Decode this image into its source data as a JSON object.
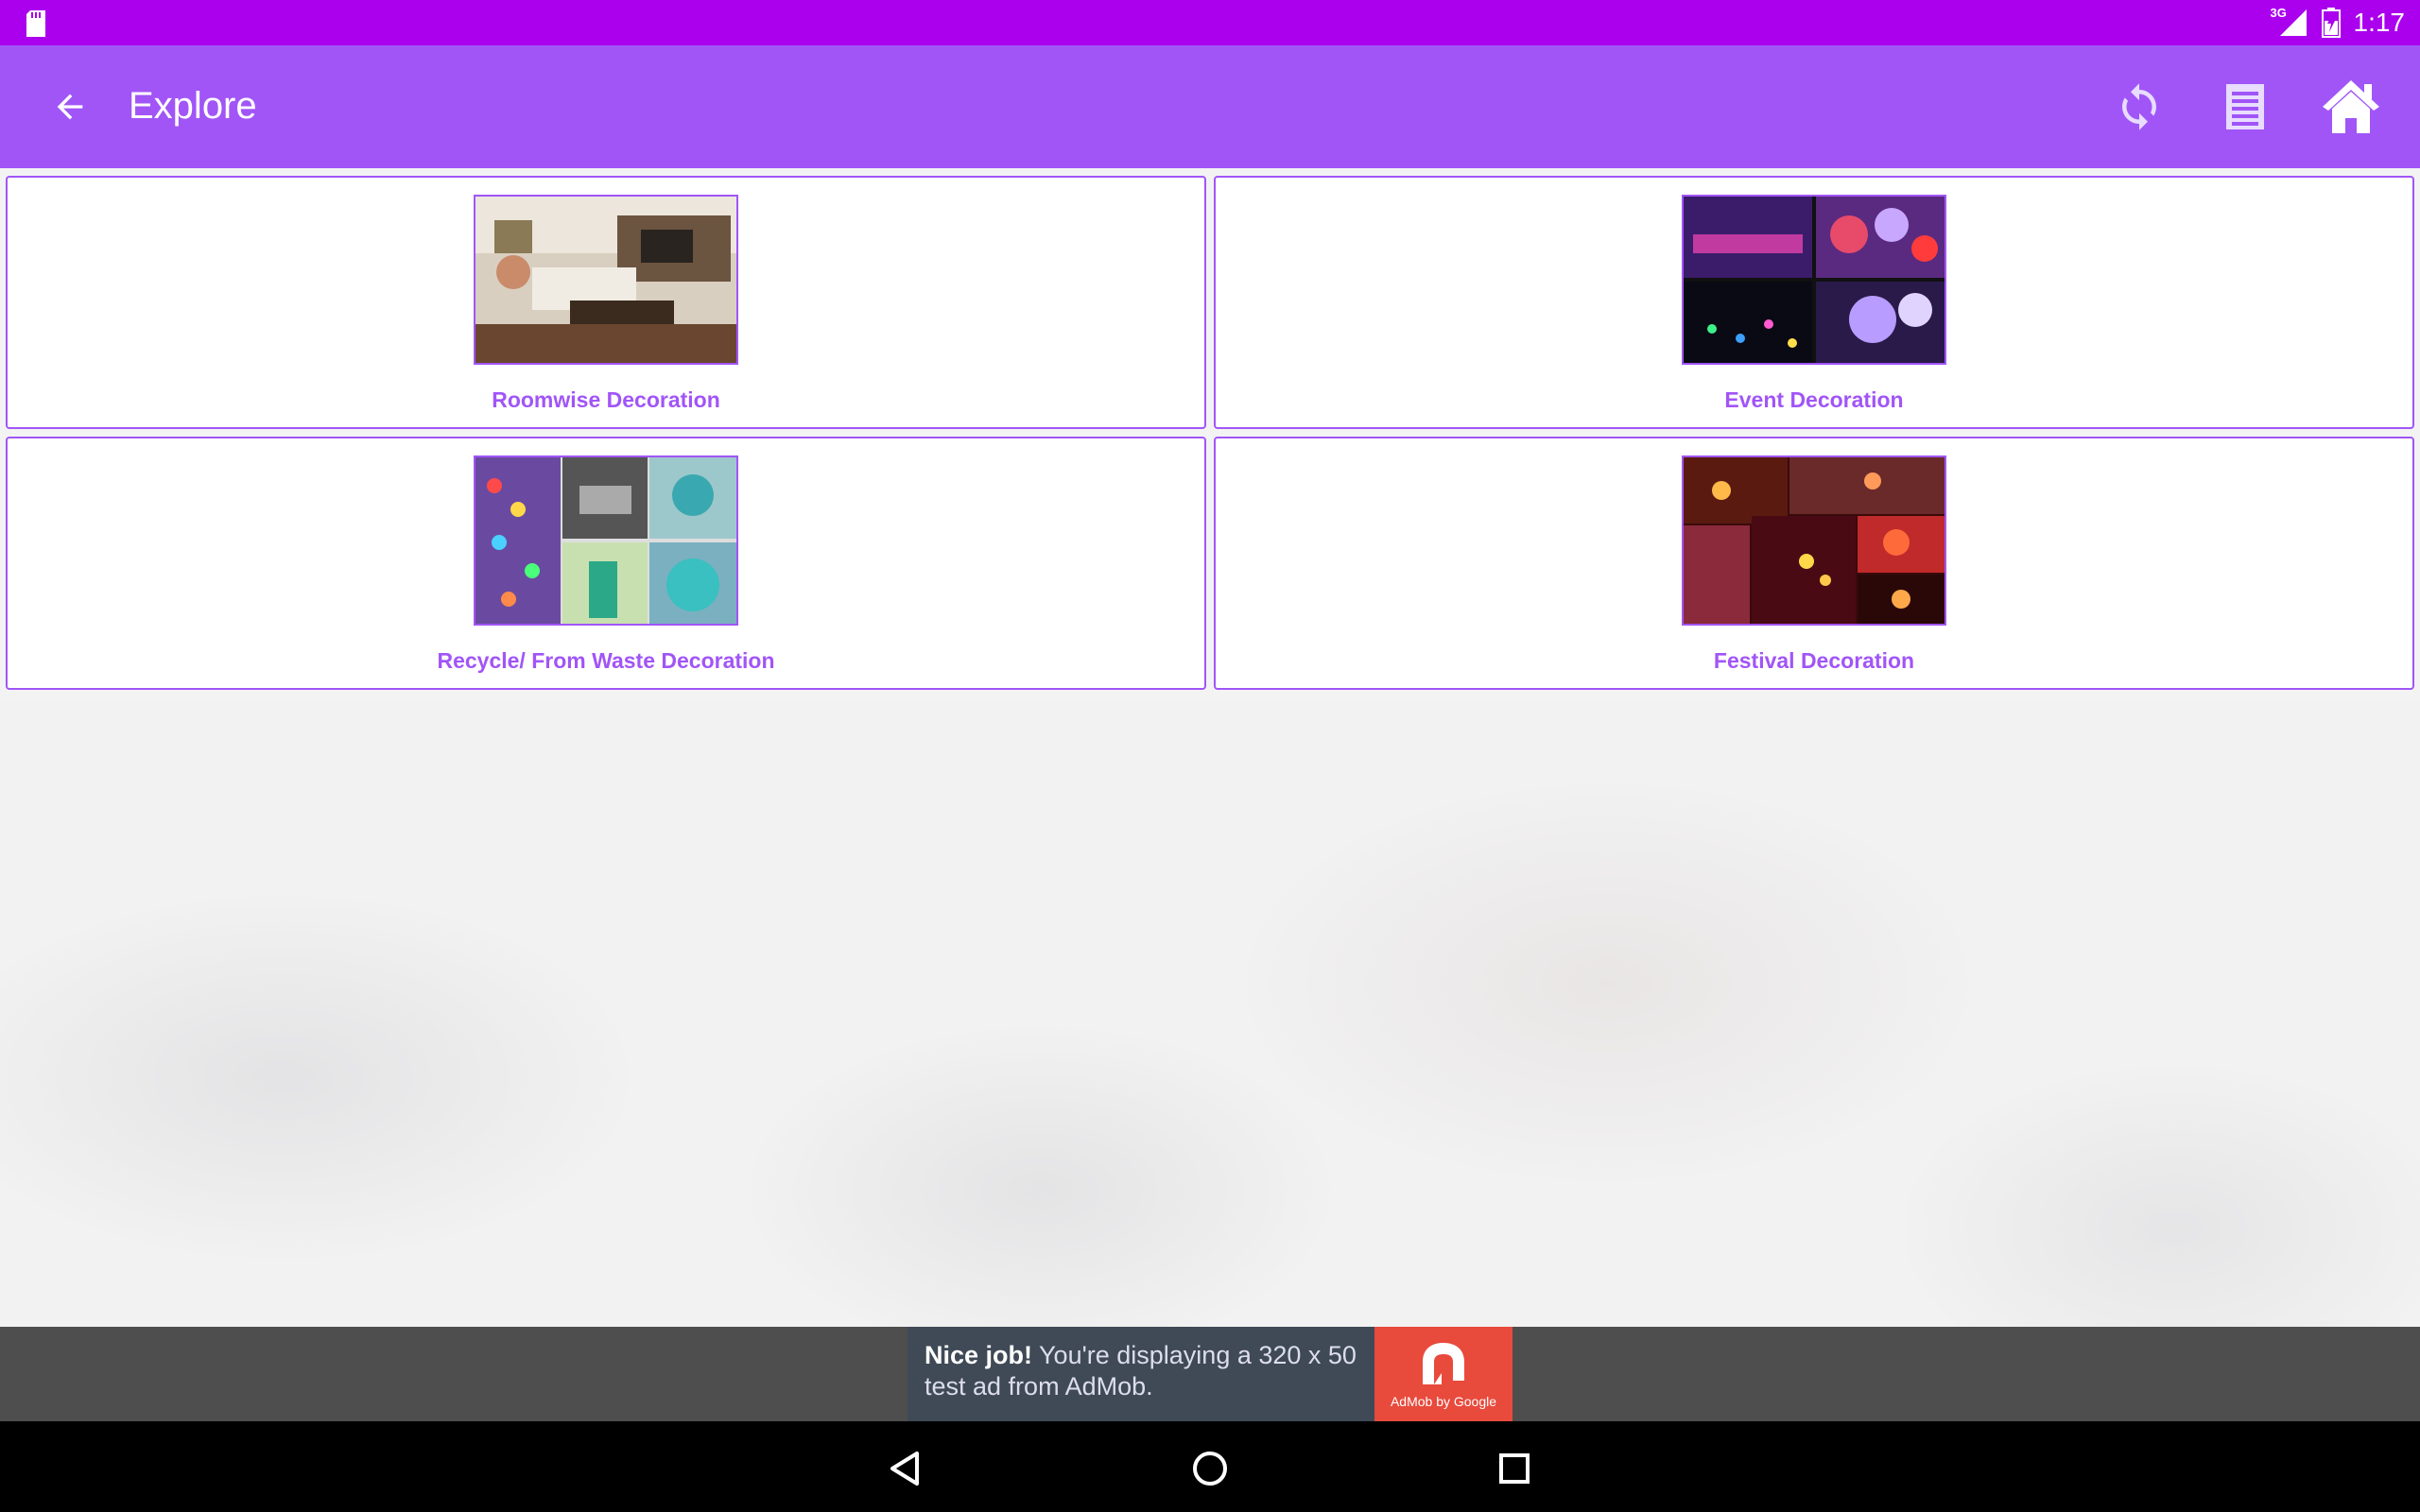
{
  "status_bar": {
    "time": "1:17",
    "network": "3G"
  },
  "app_bar": {
    "title": "Explore",
    "actions": [
      "refresh-icon",
      "list-icon",
      "home-icon"
    ]
  },
  "cards": [
    {
      "label": "Roomwise Decoration"
    },
    {
      "label": "Event Decoration"
    },
    {
      "label": "Recycle/ From Waste Decoration"
    },
    {
      "label": "Festival Decoration"
    }
  ],
  "ad": {
    "headline": "Nice job!",
    "body": "You're displaying a 320 x 50 test ad from AdMob.",
    "brand": "AdMob by Google"
  },
  "colors": {
    "status_bar": "#aa00ee",
    "app_bar": "#a155f7",
    "accent": "#a155f7"
  }
}
